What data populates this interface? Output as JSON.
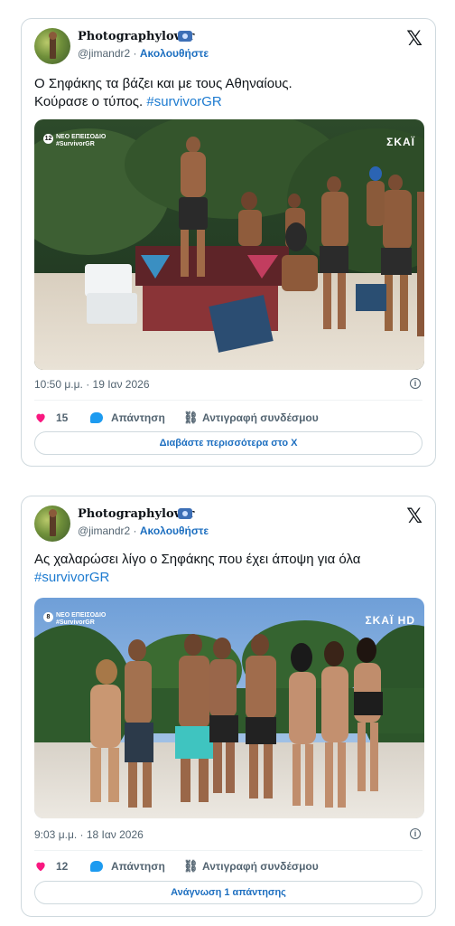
{
  "tweets": [
    {
      "display_name": "Photographylover",
      "handle": "@jimandr2",
      "separator": " · ",
      "follow_label": "Ακολουθήστε",
      "text": "Ο Σηφάκης τα βάζει και με τους Αθηναίους.",
      "text_line2": "Κούρασε ο τύπος. ",
      "hashtag": "#survivorGR",
      "media_overlay": {
        "episode_number": "12",
        "tag_line1": "ΝΕΟ ΕΠΕΙΣΟΔΙΟ",
        "tag_line2": "#SurvivorGR",
        "brand": "ΣΚΑΪ"
      },
      "timestamp": "10:50 μ.μ. · 19 Ιαν 2026",
      "likes": "15",
      "reply_label": "Απάντηση",
      "copy_link_label": "Αντιγραφή συνδέσμου",
      "footer_button": "Διαβάστε περισσότερα στο X"
    },
    {
      "display_name": "Photographylover",
      "handle": "@jimandr2",
      "separator": " · ",
      "follow_label": "Ακολουθήστε",
      "text": "Ας χαλαρώσει λίγο ο Σηφάκης που έχει άποψη για όλα",
      "text_line2": "",
      "hashtag": "#survivorGR",
      "media_overlay": {
        "episode_number": "8",
        "tag_line1": "ΝΕΟ ΕΠΕΙΣΟΔΙΟ",
        "tag_line2": "#SurvivorGR",
        "brand": "ΣΚΑΪ HD"
      },
      "timestamp": "9:03 μ.μ. · 18 Ιαν 2026",
      "likes": "12",
      "reply_label": "Απάντηση",
      "copy_link_label": "Αντιγραφή συνδέσμου",
      "footer_button": "Ανάγνωση 1 απάντησης"
    }
  ],
  "icons": {
    "x_logo": "x-logo",
    "heart": "heart-icon",
    "reply": "reply-bubble-icon",
    "link": "link-icon",
    "info": "info-icon",
    "camera": "camera-emoji-icon"
  },
  "colors": {
    "heart": "#f91880",
    "link_blue": "#1d6fc0",
    "reply_blue": "#1d9bf0",
    "border": "#cfd9de"
  }
}
